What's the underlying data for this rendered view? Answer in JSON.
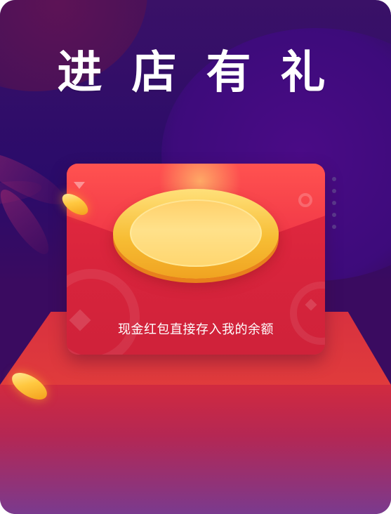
{
  "header": {
    "title": "进店有礼"
  },
  "envelope": {
    "message": "现金红包直接存入我的余额"
  },
  "colors": {
    "background": "#2a0b6a",
    "envelope_red": "#e62a40",
    "seal_gold": "#f7bd34",
    "stage_red": "#e03b3c",
    "text": "#ffffff"
  },
  "icons": [
    "triangle-icon",
    "target-icon",
    "coin-icon"
  ]
}
